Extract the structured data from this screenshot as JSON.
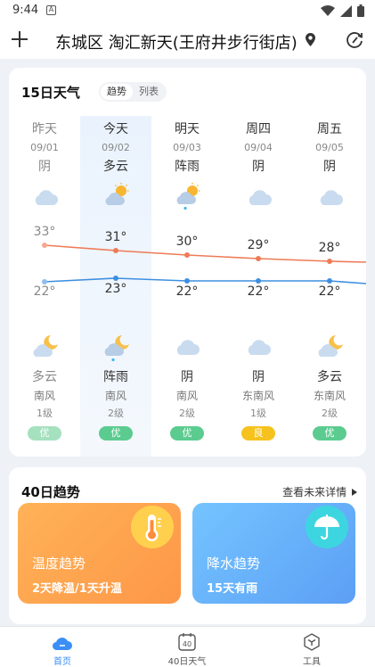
{
  "status_bar": {
    "time": "9:44",
    "notify_icon": "A"
  },
  "header": {
    "location": "东城区 淘汇新天(王府井步行街店)"
  },
  "forecast15": {
    "title": "15日天气",
    "toggle": {
      "trend": "趋势",
      "list": "列表"
    },
    "days": [
      {
        "name": "昨天",
        "date": "09/01",
        "day_cond": "阴",
        "day_icon": "cloudy-icon",
        "high": "33°",
        "low": "22°",
        "night_icon": "partly-cloudy-night-icon",
        "night_cond": "多云",
        "wind_dir": "南风",
        "wind_level": "1级",
        "aqi": "优"
      },
      {
        "name": "今天",
        "date": "09/02",
        "day_cond": "多云",
        "day_icon": "partly-cloudy-day-icon",
        "high": "31°",
        "low": "23°",
        "night_icon": "rain-night-icon",
        "night_cond": "阵雨",
        "wind_dir": "南风",
        "wind_level": "2级",
        "aqi": "优"
      },
      {
        "name": "明天",
        "date": "09/03",
        "day_cond": "阵雨",
        "day_icon": "shower-day-icon",
        "high": "30°",
        "low": "22°",
        "night_icon": "cloudy-icon",
        "night_cond": "阴",
        "wind_dir": "南风",
        "wind_level": "2级",
        "aqi": "优"
      },
      {
        "name": "周四",
        "date": "09/04",
        "day_cond": "阴",
        "day_icon": "cloudy-icon",
        "high": "29°",
        "low": "22°",
        "night_icon": "cloudy-icon",
        "night_cond": "阴",
        "wind_dir": "东南风",
        "wind_level": "1级",
        "aqi": "良"
      },
      {
        "name": "周五",
        "date": "09/05",
        "day_cond": "阴",
        "day_icon": "cloudy-icon",
        "high": "28°",
        "low": "22°",
        "night_icon": "partly-cloudy-night-icon",
        "night_cond": "多云",
        "wind_dir": "东南风",
        "wind_level": "2级",
        "aqi": "优"
      }
    ]
  },
  "trend40": {
    "title": "40日趋势",
    "more": "查看未来详情",
    "temp": {
      "name": "温度趋势",
      "desc": "2天降温/1天升温"
    },
    "rain": {
      "name": "降水趋势",
      "desc": "15天有雨"
    }
  },
  "tabs": [
    {
      "label": "首页",
      "icon": "cloud-home-icon"
    },
    {
      "label": "40日天气",
      "icon": "calendar-40-icon",
      "icon_text": "40"
    },
    {
      "label": "工具",
      "icon": "toolbox-icon"
    }
  ],
  "colors": {
    "accent": "#3a8ef6",
    "high_line": "#ee7b56",
    "low_line": "#3f8fe0",
    "aqi_excellent": "#5ccb8f",
    "aqi_good": "#f6c21e"
  }
}
